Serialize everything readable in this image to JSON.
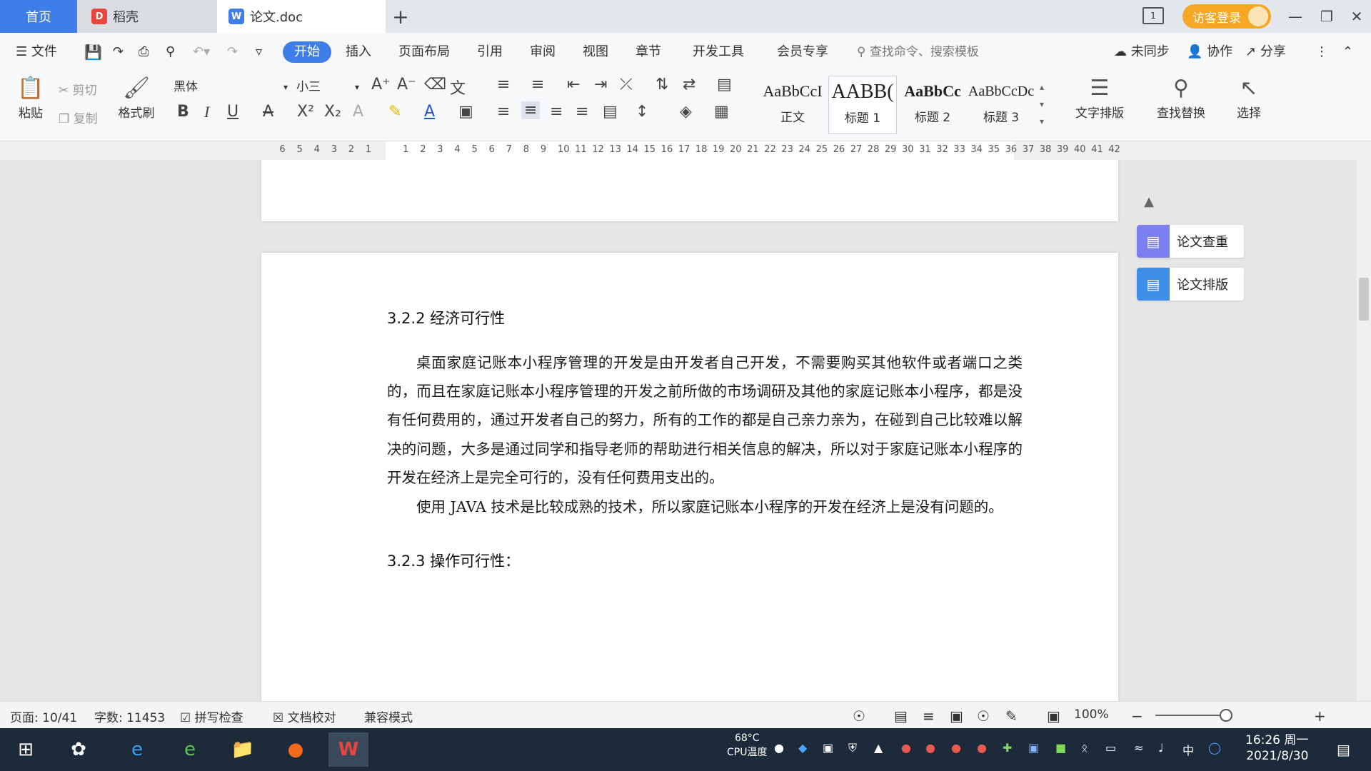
{
  "tabs": {
    "home": "首页",
    "docer": "稻壳",
    "doc": "论文.doc"
  },
  "title_right": {
    "login": "访客登录"
  },
  "menu": {
    "file": "文件",
    "items": [
      "开始",
      "插入",
      "页面布局",
      "引用",
      "审阅",
      "视图",
      "章节",
      "开发工具",
      "会员专享"
    ],
    "search_cmd": "查找命令、搜索模板",
    "right": {
      "sync": "未同步",
      "collab": "协作",
      "share": "分享"
    }
  },
  "ribbon": {
    "paste": "粘贴",
    "cut": "剪切",
    "copy": "复制",
    "format_painter": "格式刷",
    "font_name": "黑体",
    "font_size": "小三",
    "styles": [
      {
        "sample": "AaBbCcI",
        "label": "正文"
      },
      {
        "sample": "AABB(",
        "label": "标题 1"
      },
      {
        "sample": "AaBbCc",
        "label": "标题 2"
      },
      {
        "sample": "AaBbCcDc",
        "label": "标题 3"
      }
    ],
    "text_layout": "文字排版",
    "find_replace": "查找替换",
    "select": "选择"
  },
  "ruler": {
    "left_ticks": [
      "6",
      "5",
      "4",
      "3",
      "2",
      "1"
    ],
    "right_ticks": [
      "1",
      "2",
      "3",
      "4",
      "5",
      "6",
      "7",
      "8",
      "9",
      "10",
      "11",
      "12",
      "13",
      "14",
      "15",
      "16",
      "17",
      "18",
      "19",
      "20",
      "21",
      "22",
      "23",
      "24",
      "25",
      "26",
      "27",
      "28",
      "29",
      "30",
      "31",
      "32",
      "33",
      "34",
      "35",
      "36",
      "37",
      "38",
      "39",
      "40",
      "41",
      "42"
    ]
  },
  "document": {
    "heading_1": "3.2.2 经济可行性",
    "para_1": "桌面家庭记账本小程序管理的开发是由开发者自己开发，不需要购买其他软件或者端口之类的，而且在家庭记账本小程序管理的开发之前所做的市场调研及其他的家庭记账本小程序，都是没有任何费用的，通过开发者自己的努力，所有的工作的都是自己亲力亲为，在碰到自己比较难以解决的问题，大多是通过同学和指导老师的帮助进行相关信息的解决，所以对于家庭记账本小程序的开发在经济上是完全可行的，没有任何费用支出的。",
    "para_2": "使用 JAVA 技术是比较成熟的技术，所以家庭记账本小程序的开发在经济上是没有问题的。",
    "heading_2": "3.2.3 操作可行性："
  },
  "side_panel": {
    "check": "论文查重",
    "layout": "论文排版"
  },
  "status": {
    "page": "页面: 10/41",
    "words": "字数: 11453",
    "spell": "拼写检查",
    "proof": "文档校对",
    "compat": "兼容模式",
    "zoom": "100%"
  },
  "taskbar": {
    "cpu_temp": "68°C",
    "cpu_label": "CPU温度",
    "ime": "中",
    "time": "16:26 周一",
    "date": "2021/8/30"
  },
  "colors": {
    "accent": "#3f7ee8",
    "login": "#f5a623",
    "taskbar": "#1c2a3a"
  }
}
